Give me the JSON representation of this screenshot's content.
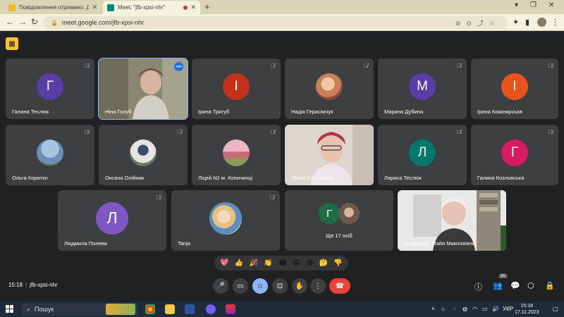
{
  "browser": {
    "tabs": [
      {
        "title": "Повідомлення отримано. Дяку",
        "active": false,
        "favicon_color": "#f2b81f"
      },
      {
        "title": "Meet: \"jfb-xpsi-nhr\"",
        "active": true,
        "favicon_color": "#00897b"
      }
    ],
    "url": "meet.google.com/jfb-xpsi-nhr"
  },
  "participants": [
    {
      "name": "Галина Теслюк",
      "initial": "Г",
      "color": "#5b3ea5",
      "muted": true
    },
    {
      "name": "Ніна Голуб",
      "video": true,
      "muted": false,
      "active": true
    },
    {
      "name": "Ірина Тригуб",
      "initial": "І",
      "color": "#c5321b",
      "muted": true
    },
    {
      "name": "Надія Герасімчук",
      "photo": true,
      "photo_color": "#c9805a",
      "muted": true
    },
    {
      "name": "Марина Дубина",
      "initial": "М",
      "color": "#5b3ea5",
      "muted": true
    },
    {
      "name": "Ірина Комінярська",
      "initial": "І",
      "color": "#e8531c",
      "muted": true
    },
    {
      "name": "Ольга Коритко",
      "photo": true,
      "photo_color": "#6c8fb8",
      "muted": true
    },
    {
      "name": "Оксана Олійник",
      "photo": true,
      "photo_color": "#6b7a5e",
      "muted": true
    },
    {
      "name": "Ліцей N2 м. Копичинці",
      "photo": true,
      "photo_color": "#c46b78",
      "muted": true
    },
    {
      "name": "Olena Goroshkina",
      "video": true,
      "muted": false
    },
    {
      "name": "Лариса Теслюк",
      "initial": "Л",
      "color": "#00796b",
      "muted": true
    },
    {
      "name": "Галина Козловська",
      "initial": "Г",
      "color": "#d81b60",
      "muted": true
    },
    {
      "name": "Людмила Полева",
      "initial": "Л",
      "color": "#7e57c2",
      "muted": true
    },
    {
      "name": "Tanja",
      "photo": true,
      "photo_color": "#e9c07a",
      "muted": true
    },
    {
      "name": "Кондирєва Майя Миколаївна",
      "video": true,
      "muted": false
    }
  ],
  "more_tile": {
    "label": "Ще 17 осіб",
    "initial": "Г",
    "color": "#1e6b45"
  },
  "reactions": [
    "💖",
    "👍",
    "🎉",
    "👏",
    "😂",
    "😮",
    "😢",
    "🤔",
    "👎"
  ],
  "meeting": {
    "time": "15:18",
    "code": "jfb-xpsi-nhr",
    "participant_count": "30"
  },
  "taskbar": {
    "search_placeholder": "Пошук",
    "lang": "УКР",
    "time": "15:18",
    "date": "17.11.2023"
  }
}
